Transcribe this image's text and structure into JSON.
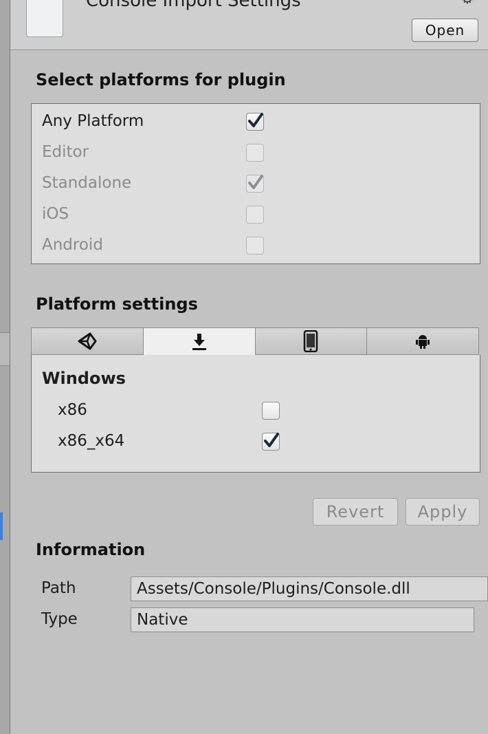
{
  "header": {
    "title": "Console Import Settings",
    "open_label": "Open"
  },
  "plugin_platforms": {
    "title": "Select platforms for plugin",
    "items": [
      {
        "label": "Any Platform",
        "checked": true,
        "enabled": true
      },
      {
        "label": "Editor",
        "checked": false,
        "enabled": false
      },
      {
        "label": "Standalone",
        "checked": true,
        "enabled": false
      },
      {
        "label": "iOS",
        "checked": false,
        "enabled": false
      },
      {
        "label": "Android",
        "checked": false,
        "enabled": false
      }
    ]
  },
  "platform_settings": {
    "title": "Platform settings",
    "tabs": [
      {
        "icon": "unity-icon",
        "active": false
      },
      {
        "icon": "download-icon",
        "active": true
      },
      {
        "icon": "phone-icon",
        "active": false
      },
      {
        "icon": "android-icon",
        "active": false
      }
    ],
    "section_title": "Windows",
    "options": [
      {
        "label": "x86",
        "checked": false
      },
      {
        "label": "x86_x64",
        "checked": true
      }
    ]
  },
  "actions": {
    "revert_label": "Revert",
    "apply_label": "Apply"
  },
  "information": {
    "title": "Information",
    "path_label": "Path",
    "path_value": "Assets/Console/Plugins/Console.dll",
    "type_label": "Type",
    "type_value": "Native"
  },
  "colors": {
    "panel_bg": "#c2c2c2",
    "box_bg": "#dedede",
    "checkmark": "#1a2a3a",
    "checkmark_disabled": "#8a8f95"
  }
}
